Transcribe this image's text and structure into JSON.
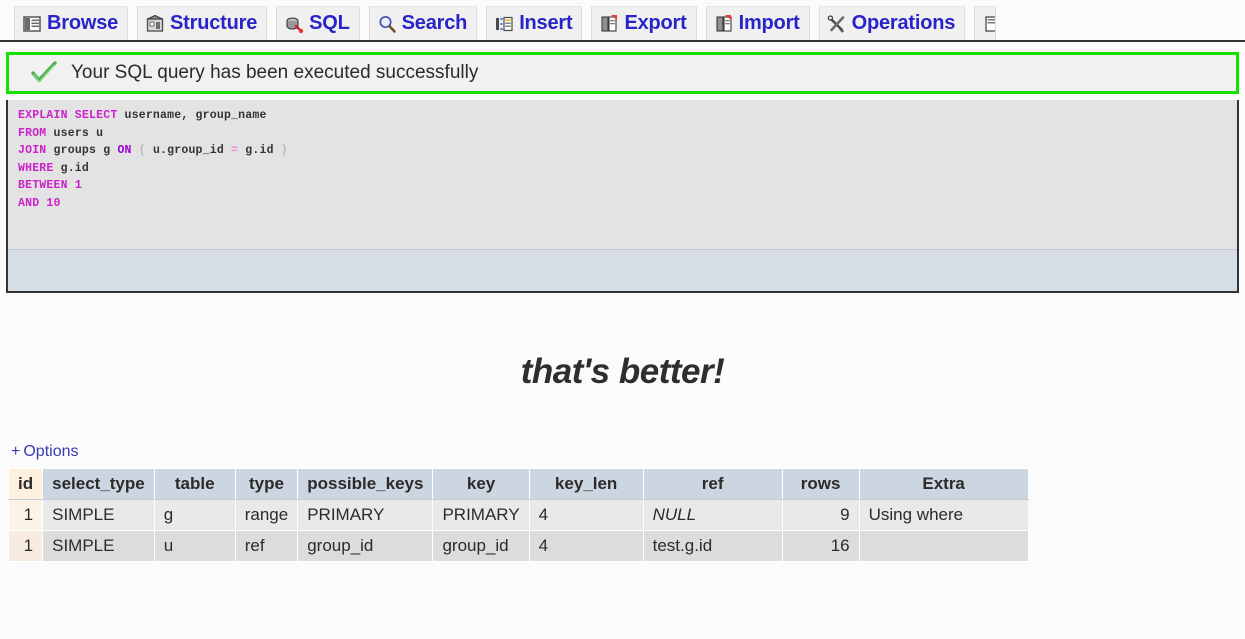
{
  "tabs": [
    {
      "label": "Browse",
      "icon": "browse-icon"
    },
    {
      "label": "Structure",
      "icon": "structure-icon"
    },
    {
      "label": "SQL",
      "icon": "sql-icon"
    },
    {
      "label": "Search",
      "icon": "search-icon"
    },
    {
      "label": "Insert",
      "icon": "insert-icon"
    },
    {
      "label": "Export",
      "icon": "export-icon"
    },
    {
      "label": "Import",
      "icon": "import-icon"
    },
    {
      "label": "Operations",
      "icon": "operations-icon"
    },
    {
      "label": "",
      "icon": "more-icon"
    }
  ],
  "notice": {
    "icon": "checkmark-icon",
    "message": "Your SQL query has been executed successfully",
    "border_color": "#16e000"
  },
  "query": {
    "lines": [
      [
        {
          "t": "EXPLAIN SELECT ",
          "c": "kw"
        },
        {
          "t": "username, group_name",
          "c": "id"
        }
      ],
      [
        {
          "t": "FROM ",
          "c": "kw"
        },
        {
          "t": "users u",
          "c": "id"
        }
      ],
      [
        {
          "t": "JOIN ",
          "c": "kw"
        },
        {
          "t": "groups g ",
          "c": "id"
        },
        {
          "t": "ON ",
          "c": "on"
        },
        {
          "t": "( ",
          "c": "paren"
        },
        {
          "t": "u.group_id ",
          "c": "id"
        },
        {
          "t": "= ",
          "c": "op"
        },
        {
          "t": "g.id ",
          "c": "id"
        },
        {
          "t": ")",
          "c": "paren"
        }
      ],
      [
        {
          "t": "WHERE ",
          "c": "kw"
        },
        {
          "t": "g.id",
          "c": "id"
        }
      ],
      [
        {
          "t": "BETWEEN ",
          "c": "kw"
        },
        {
          "t": "1",
          "c": "num"
        }
      ],
      [
        {
          "t": "AND ",
          "c": "kw"
        },
        {
          "t": "10",
          "c": "num"
        }
      ]
    ]
  },
  "heading": "that's better!",
  "options": {
    "plus": "+",
    "label": "Options"
  },
  "explain_table": {
    "columns": [
      "id",
      "select_type",
      "table",
      "type",
      "possible_keys",
      "key",
      "key_len",
      "ref",
      "rows",
      "Extra"
    ],
    "rows": [
      {
        "id": "1",
        "select_type": "SIMPLE",
        "table": "g",
        "type": "range",
        "possible_keys": "PRIMARY",
        "key": "PRIMARY",
        "key_len": "4",
        "ref": "NULL",
        "ref_is_null": true,
        "rows": "9",
        "Extra": "Using where"
      },
      {
        "id": "1",
        "select_type": "SIMPLE",
        "table": "u",
        "type": "ref",
        "possible_keys": "group_id",
        "key": "group_id",
        "key_len": "4",
        "ref": "test.g.id",
        "ref_is_null": false,
        "rows": "16",
        "Extra": ""
      }
    ]
  },
  "colors": {
    "tab_label": "#2a24c8",
    "success_border": "#16e000",
    "sql_keyword": "#cc22cc",
    "sql_identifier": "#333333",
    "table_header_bg": "#ccd6e0",
    "id_column_bg": "#fdf0e0"
  }
}
